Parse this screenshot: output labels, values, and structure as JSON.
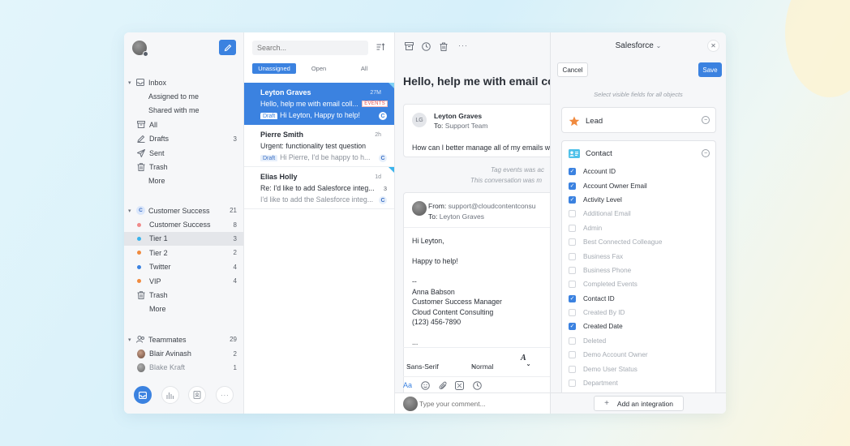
{
  "sidebar": {
    "inbox": {
      "label": "Inbox"
    },
    "inbox_items": [
      {
        "label": "Assigned to me",
        "count": ""
      },
      {
        "label": "Shared with me",
        "count": ""
      },
      {
        "label": "All",
        "count": "",
        "icon": "archive-icon"
      },
      {
        "label": "Drafts",
        "count": "3",
        "icon": "drafts-icon"
      },
      {
        "label": "Sent",
        "count": "",
        "icon": "sent-icon"
      },
      {
        "label": "Trash",
        "count": "",
        "icon": "trash-icon"
      },
      {
        "label": "More",
        "count": ""
      }
    ],
    "team": {
      "label": "Customer Success",
      "count": "21",
      "badge": "C"
    },
    "team_items": [
      {
        "label": "Customer Success",
        "count": "8",
        "color": "#f08a8a"
      },
      {
        "label": "Tier 1",
        "count": "3",
        "color": "#3ab3ec"
      },
      {
        "label": "Tier 2",
        "count": "2",
        "color": "#f08a3e"
      },
      {
        "label": "Twitter",
        "count": "4",
        "color": "#3b82e0"
      },
      {
        "label": "VIP",
        "count": "4",
        "color": "#f08a3e"
      },
      {
        "label": "Trash",
        "count": ""
      },
      {
        "label": "More",
        "count": ""
      }
    ],
    "teammates": {
      "label": "Teammates",
      "count": "29"
    },
    "teammate_items": [
      {
        "label": "Blair Avinash",
        "count": "2"
      },
      {
        "label": "Blake Kraft",
        "count": "1"
      }
    ]
  },
  "list": {
    "search_placeholder": "Search...",
    "tabs": [
      "Unassigned",
      "Open",
      "All"
    ],
    "conversations": [
      {
        "name": "Leyton Graves",
        "time": "27M",
        "subject": "Hello, help me with email coll...",
        "tag": "EVENTS",
        "draft": "Draft",
        "preview": "Hi Leyton, Happy to help!",
        "badge": "C"
      },
      {
        "name": "Pierre Smith",
        "time": "2h",
        "subject": "Urgent: functionality test question",
        "draft": "Draft",
        "preview": "Hi Pierre, I'd be happy to h...",
        "badge": "C"
      },
      {
        "name": "Elias Holly",
        "time": "1d",
        "subject": "Re: I'd like to add Salesforce integ...",
        "count": "3",
        "preview": "I'd like to add the Salesforce integ...",
        "badge": "C"
      }
    ]
  },
  "thread": {
    "subject": "Hello, help me with email co",
    "first": {
      "initials": "LG",
      "from": "Leyton Graves",
      "to_label": "To:",
      "to": "Support Team",
      "body": "How can I better manage all of my emails w"
    },
    "note1": "Tag events was ac",
    "note2": "This conversation was m",
    "reply": {
      "from_label": "From:",
      "from": "support@cloudcontentconsu",
      "to_label": "To:",
      "to": "Leyton Graves",
      "lines": [
        "Hi Leyton,",
        "",
        "Happy to help!",
        "",
        "--",
        "Anna Babson",
        "Customer Success Manager",
        "Cloud Content Consulting",
        "(123) 456-7890",
        "",
        "..."
      ]
    },
    "font": "Sans-Serif",
    "size": "Normal",
    "text_tool": "Aa",
    "comment_placeholder": "Type your comment..."
  },
  "panel": {
    "title": "Salesforce",
    "cancel": "Cancel",
    "save": "Save",
    "hint": "Select visible fields for all objects",
    "lead": {
      "label": "Lead",
      "toggle": "−"
    },
    "contact": {
      "label": "Contact",
      "toggle": "−"
    },
    "fields": [
      {
        "label": "Account ID",
        "checked": true
      },
      {
        "label": "Account Owner Email",
        "checked": true
      },
      {
        "label": "Activity Level",
        "checked": true
      },
      {
        "label": "Additional Email",
        "checked": false
      },
      {
        "label": "Admin",
        "checked": false
      },
      {
        "label": "Best Connected Colleague",
        "checked": false
      },
      {
        "label": "Business Fax",
        "checked": false
      },
      {
        "label": "Business Phone",
        "checked": false
      },
      {
        "label": "Completed Events",
        "checked": false
      },
      {
        "label": "Contact ID",
        "checked": true
      },
      {
        "label": "Created By ID",
        "checked": false
      },
      {
        "label": "Created Date",
        "checked": true
      },
      {
        "label": "Deleted",
        "checked": false
      },
      {
        "label": "Demo Account Owner",
        "checked": false
      },
      {
        "label": "Demo User Status",
        "checked": false
      },
      {
        "label": "Department",
        "checked": false
      }
    ],
    "add_integration": "Add an integration"
  },
  "colors": {
    "accent": "#3b82e0",
    "lead_star": "#f08a3e",
    "contact_card": "#4fc1e9"
  }
}
